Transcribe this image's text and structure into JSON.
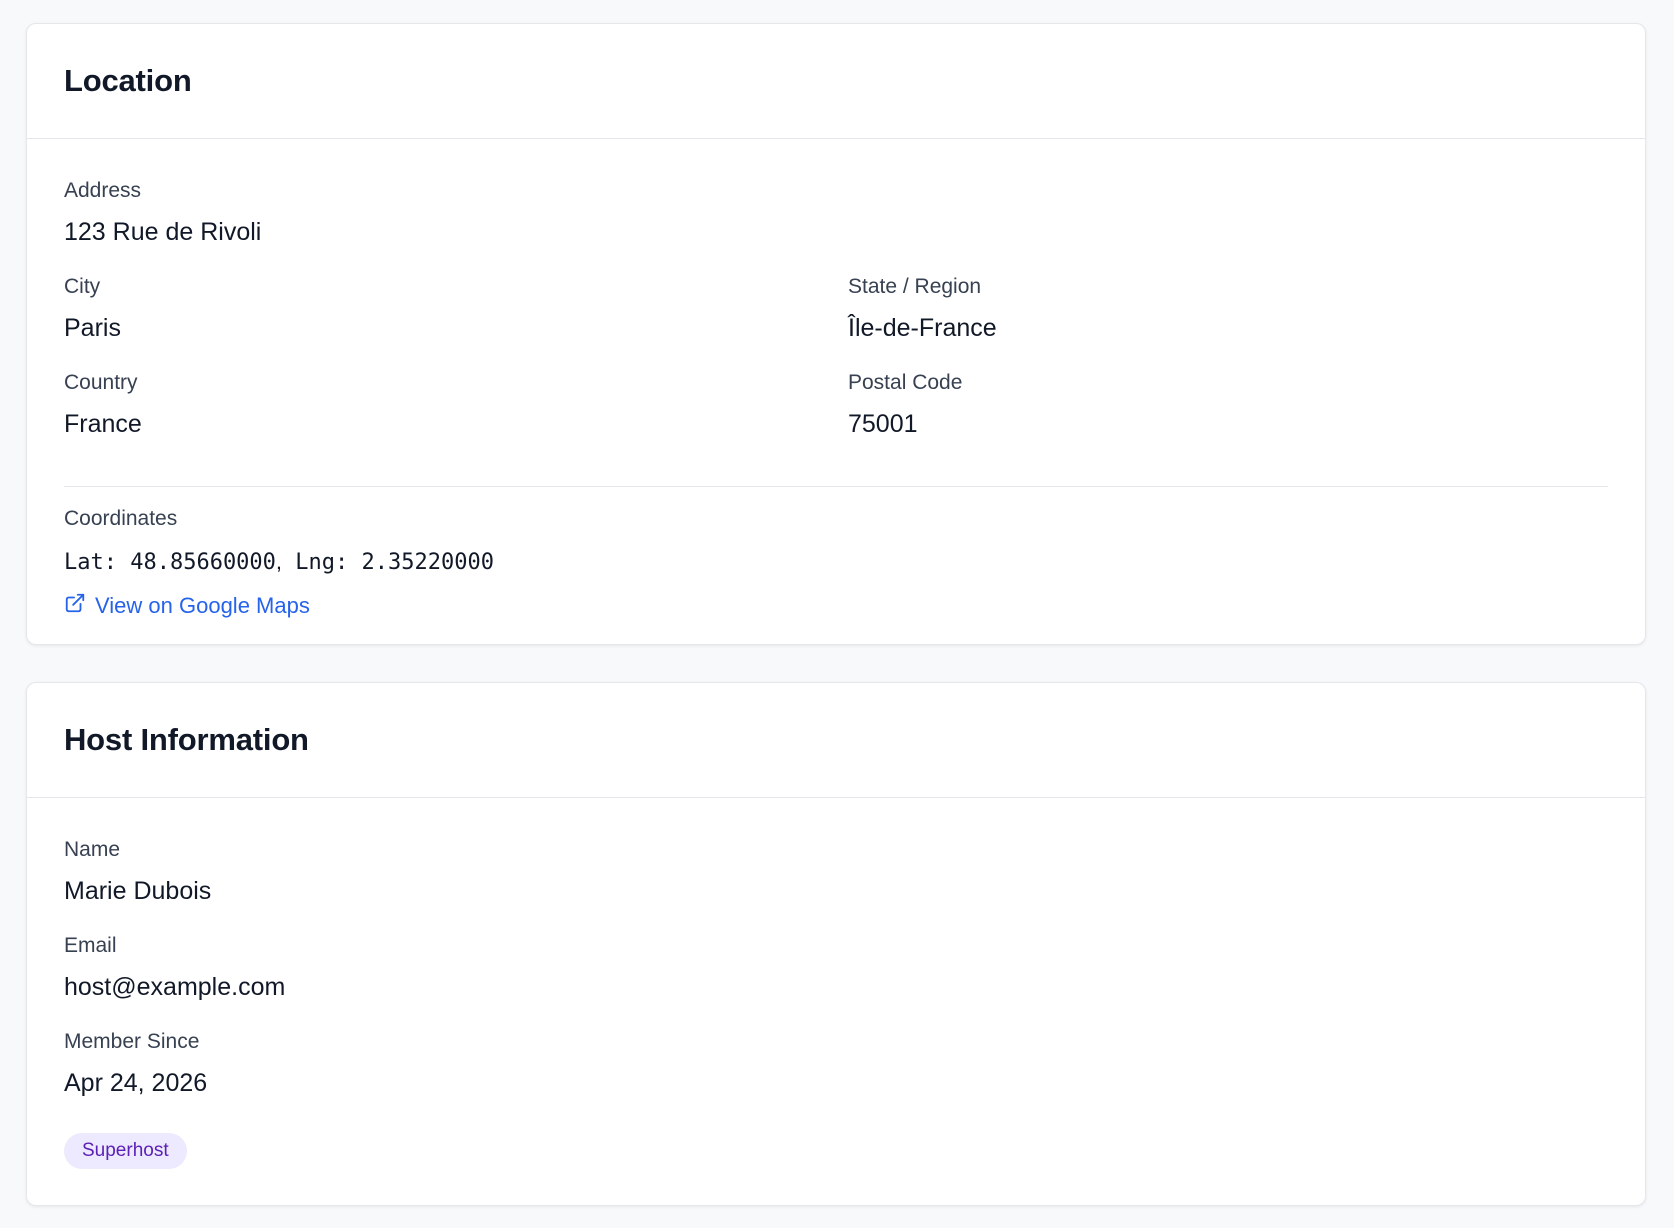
{
  "location": {
    "title": "Location",
    "address": {
      "label": "Address",
      "value": "123 Rue de Rivoli"
    },
    "city": {
      "label": "City",
      "value": "Paris"
    },
    "state": {
      "label": "State / Region",
      "value": "Île-de-France"
    },
    "country": {
      "label": "Country",
      "value": "France"
    },
    "postal_code": {
      "label": "Postal Code",
      "value": "75001"
    },
    "coordinates": {
      "label": "Coordinates",
      "lat_text": "Lat: 48.85660000",
      "separator": ",",
      "lng_text": "Lng: 2.35220000"
    },
    "map_link": {
      "label": "View on Google Maps",
      "icon": "external-link-icon"
    }
  },
  "host": {
    "title": "Host Information",
    "name": {
      "label": "Name",
      "value": "Marie Dubois"
    },
    "email": {
      "label": "Email",
      "value": "host@example.com"
    },
    "member_since": {
      "label": "Member Since",
      "value": "Apr 24, 2026"
    },
    "badge": "Superhost"
  },
  "colors": {
    "background": "#f8f9fb",
    "link": "#2563eb",
    "badge_bg": "#ede9fe",
    "badge_text": "#5b21b6"
  }
}
